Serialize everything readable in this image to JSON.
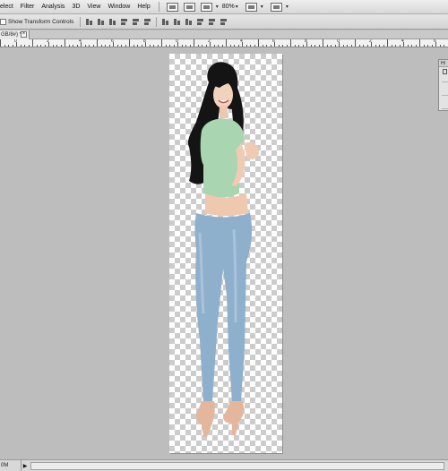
{
  "menu": {
    "items": [
      "elect",
      "Filter",
      "Analysis",
      "3D",
      "View",
      "Window",
      "Help"
    ],
    "zoom": "80%"
  },
  "options": {
    "show_transform_controls": "Show Transform Controls"
  },
  "document": {
    "tab_label": "GB/8#) *",
    "close_glyph": "×"
  },
  "ruler": {
    "labels": [
      "0",
      "2",
      "4",
      "6",
      "8",
      "0",
      "2",
      "4",
      "6",
      "8",
      "0",
      "2",
      "4",
      "6"
    ]
  },
  "panel": {
    "title": "HI"
  },
  "status": {
    "zoom_text": "0M",
    "arrow": "▶"
  },
  "colors": {
    "workspace": "#bdbdbd",
    "top_color": "#a9d6b0",
    "jeans": "#8fb0cc",
    "heels": "#e4b79c",
    "hair": "#141414"
  }
}
